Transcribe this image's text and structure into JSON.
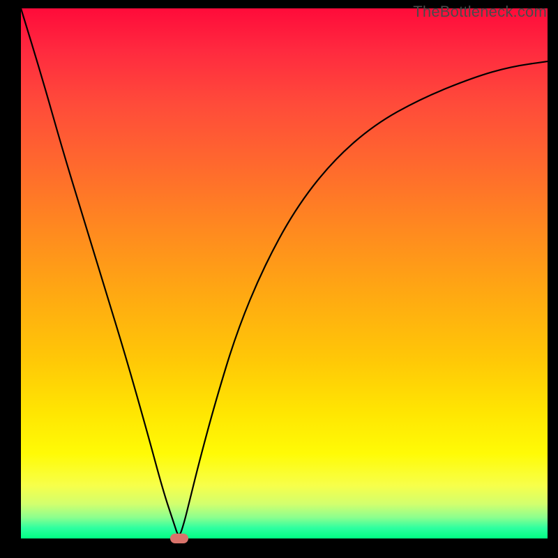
{
  "watermark": "TheBottleneck.com",
  "chart_data": {
    "type": "line",
    "title": "",
    "xlabel": "",
    "ylabel": "",
    "xlim": [
      0,
      100
    ],
    "ylim": [
      0,
      100
    ],
    "series": [
      {
        "name": "curve",
        "x": [
          0,
          4,
          8,
          12,
          16,
          20,
          24,
          27,
          29,
          30,
          31,
          32,
          34,
          37,
          41,
          46,
          52,
          59,
          67,
          76,
          86,
          93,
          100
        ],
        "y": [
          100,
          87,
          73,
          60,
          47,
          34,
          20,
          9,
          3,
          0,
          3,
          7,
          15,
          26,
          39,
          51,
          62,
          71,
          78,
          83,
          87,
          89,
          90
        ]
      }
    ],
    "annotations": [
      {
        "name": "min-marker",
        "x": 30,
        "y": 0,
        "color": "#d9736b"
      }
    ],
    "background_gradient": {
      "top": "#ff0b3a",
      "mid_top": "#ff8a1f",
      "mid": "#ffe502",
      "mid_bottom": "#d2ff6e",
      "bottom": "#00ff83"
    }
  }
}
